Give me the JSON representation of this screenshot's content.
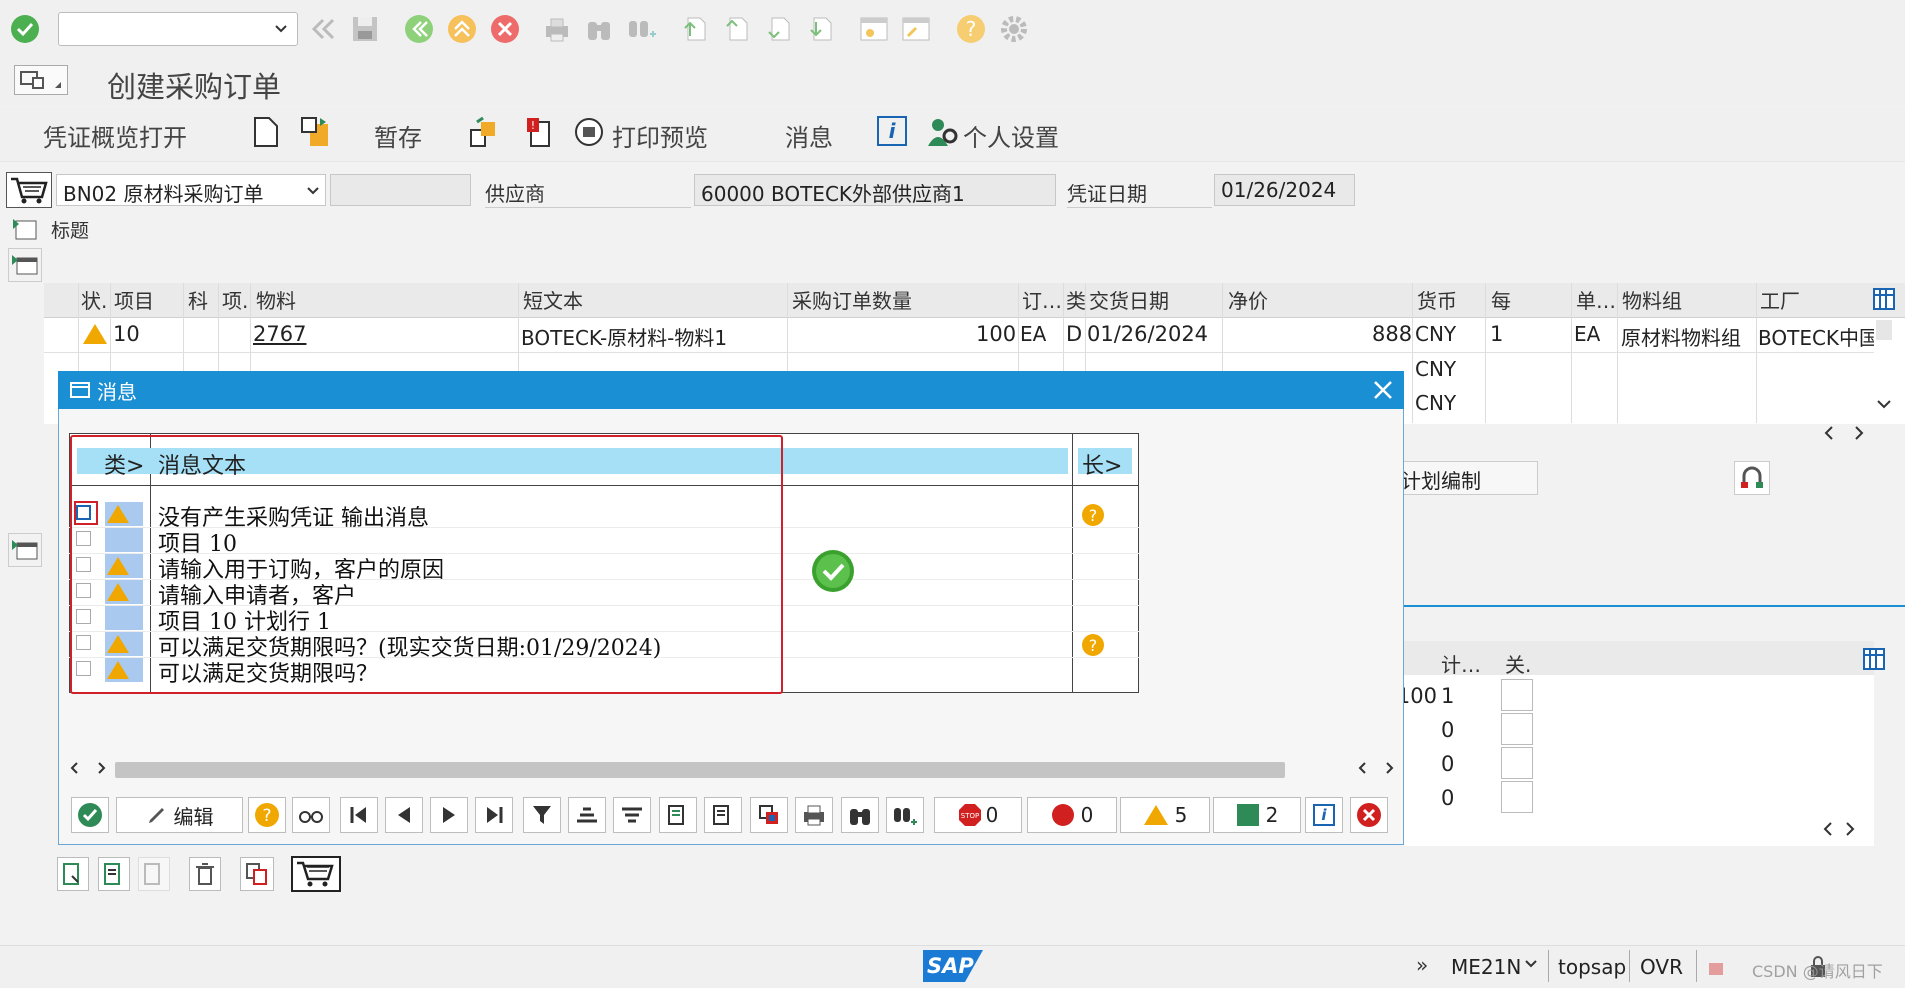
{
  "window": {
    "title": "创建采购订单"
  },
  "app_toolbar": {
    "overview_open": "凭证概览打开",
    "hold": "暂存",
    "print_preview": "打印预览",
    "messages": "消息",
    "personal_settings": "个人设置"
  },
  "header": {
    "order_type": "BN02 原材料采购订单",
    "vendor_label": "供应商",
    "vendor_value": "60000 BOTECK外部供应商1",
    "doc_date_label": "凭证日期",
    "doc_date_value": "01/26/2024",
    "heading_label": "标题"
  },
  "items_table": {
    "columns": [
      "状.",
      "项目",
      "科",
      "项.",
      "物料",
      "短文本",
      "采购订单数量",
      "订…",
      "类",
      "交货日期",
      "净价",
      "货币",
      "每",
      "单…",
      "物料组",
      "工厂"
    ],
    "row1": {
      "item": "10",
      "material": "2767",
      "short_text": "BOTECK-原材料-物料1",
      "quantity": "100",
      "unit": "EA",
      "category": "D",
      "delivery_date": "01/26/2024",
      "net_price": "888",
      "currency": "CNY",
      "per": "1",
      "order_unit": "EA",
      "material_group": "原材料物料组",
      "plant": "BOTECK中国"
    },
    "row2_currency": "CNY",
    "row3_currency": "CNY"
  },
  "behind": {
    "schedule_btn": "计划编制",
    "schedule_table": {
      "columns": [
        "计…",
        "关."
      ],
      "qty_fragment": "100",
      "rows": [
        "1",
        "0",
        "0",
        "0"
      ]
    }
  },
  "popup": {
    "title": "消息",
    "col_type": "类>",
    "col_text": "消息文本",
    "col_long": "长>",
    "messages": [
      "没有产生采购凭证  输出消息",
      "项目 10",
      "请输入用于订购，客户的原因",
      "请输入申请者，客户",
      "项目 10 计划行 1",
      "可以满足交货期限吗？(现实交货日期:01/29/2024)",
      "可以满足交货期限吗？"
    ],
    "edit_btn": "编辑",
    "count_stop": "0",
    "count_error": "0",
    "count_warning": "5",
    "count_success": "2"
  },
  "statusbar": {
    "tcode": "ME21N",
    "system": "topsap",
    "mode": "OVR",
    "watermark": "CSDN @请风日下",
    "logo": "SAP"
  }
}
